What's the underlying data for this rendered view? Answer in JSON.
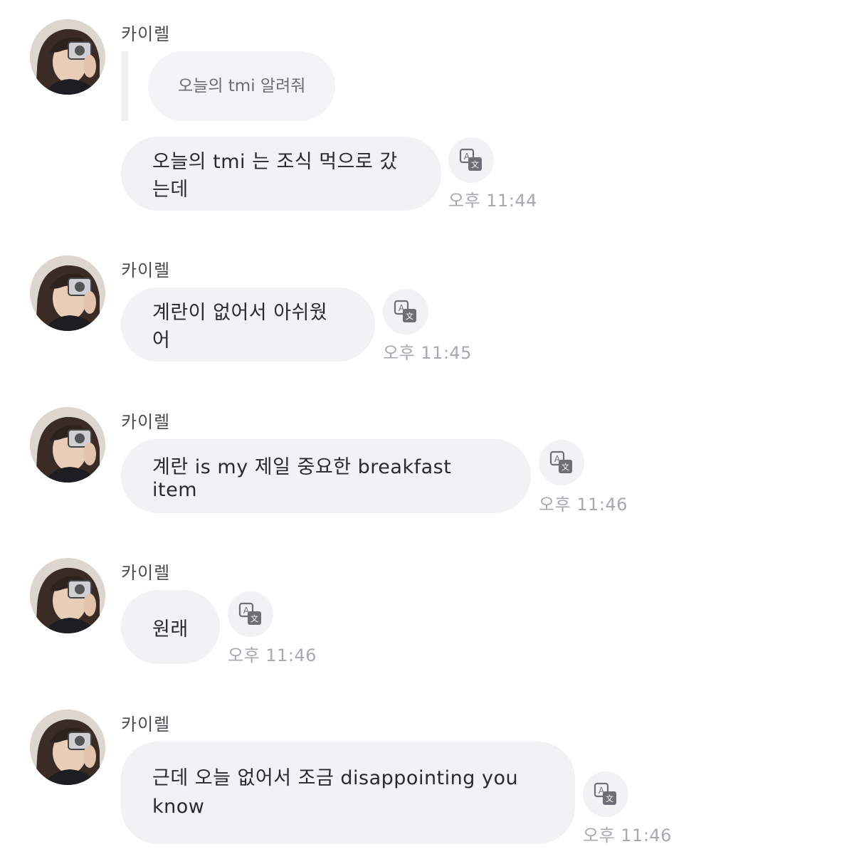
{
  "messages": [
    {
      "sender": "카이렐",
      "reply_text": "오늘의 tmi 알려줘",
      "text": "오늘의 tmi 는 조식 먹으로 갔는데",
      "time": "오후 11:44"
    },
    {
      "sender": "카이렐",
      "text": "계란이 없어서 아쉬웠어",
      "time": "오후 11:45"
    },
    {
      "sender": "카이렐",
      "text": "계란 is my 제일 중요한 breakfast item",
      "time": "오후 11:46"
    },
    {
      "sender": "카이렐",
      "text": "원래",
      "time": "오후 11:46"
    },
    {
      "sender": "카이렐",
      "text_line1": "근데 오늘 없어서 조금 disappointing you",
      "text_line2": "know",
      "time": "오후 11:46"
    }
  ],
  "icons": {
    "avatar": "profile-photo",
    "translate": "translate-icon"
  },
  "colors": {
    "bubble": "#f2f2f4",
    "timestamp": "#a8a8ae",
    "sender": "#4a4a4e",
    "icon": "#6e6e74"
  }
}
